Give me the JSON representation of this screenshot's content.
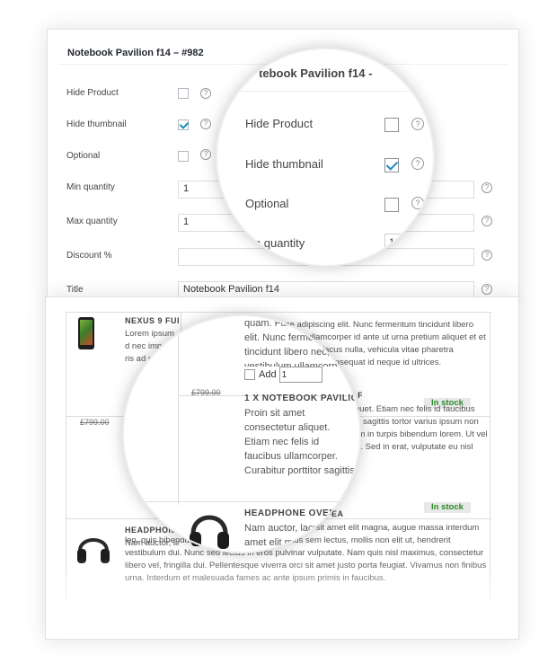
{
  "settings_panel": {
    "title": "Notebook Pavilion f14 – #982",
    "help_glyph": "?",
    "fields": {
      "hide_product": {
        "label": "Hide Product",
        "checked": false
      },
      "hide_thumbnail": {
        "label": "Hide thumbnail",
        "checked": true
      },
      "optional": {
        "label": "Optional",
        "checked": false
      },
      "min_quantity": {
        "label": "Min quantity",
        "value": "1"
      },
      "max_quantity": {
        "label": "Max quantity",
        "value": "1"
      },
      "discount": {
        "label": "Discount %",
        "value": ""
      },
      "title": {
        "label": "Title",
        "value": "Notebook Pavilion f14"
      }
    }
  },
  "zoom_top": {
    "title_fragment": "tebook Pavilion f14 -",
    "hide_product": "Hide Product",
    "hide_thumbnail": "Hide thumbnail",
    "optional": "Optional",
    "min_quantity_fragment": "in quantity",
    "min_value_fragment": "1"
  },
  "product_list": {
    "items": [
      {
        "title": "NEXUS 9 FULLHD",
        "desc": "Lorem ipsum d nec impe ris ad erat.",
        "old_price": "£799.00",
        "icon": "tablet-icon"
      },
      {
        "title": "1 X NOTEBOOK PAVILION F14",
        "desc": "Proin sit amet consectetur aliquet. Etiam nec felis id faucibus ullamcorper. Curabitur porttitor sagittis tortor varius ipsum non felis vulputate. Vivamus at enim in turpis bibendum lorem. Ut vel nibh rhoncus orci tincidunt sed. Sed in erat, vulputate eu nisl sed, semper",
        "old_price": "£799.00",
        "stock": "In stock"
      },
      {
        "title": "HEADPHONE OVER-EAR",
        "desc": "Nam auctor, lacus sit amet elit magna, augue massa interdum leo, quis bibendum elit magna id odio. Vivamus sem lectus, mollis non elit ut, hendrerit vestibulum dui. Nunc sed lectus in eros pulvinar vulputate. Nam quis nisl maximus, consectetur libero vel, fringilla dui. Pellentesque viverra orci sit amet justo porta feugiat. Vivamus non finibus urna. Interdum et malesuada fames ac ante ipsum primis in faucibus.",
        "stock": "In stock",
        "icon": "headphones-icon"
      }
    ],
    "top_text": "quam. Fusce adipiscing elit. Nunc fermentum tincidunt libero nec, vestibulum ullamcorper id ante ut urna pretium aliquet et et erat. Nunc interdum lacus nulla, vehicula vitae pharetra vulputate ipsum nec, consequat id neque id ultrices.",
    "add_label": "Add",
    "add_qty": "1",
    "small_headphone_title": "HEADPHONE OVER-EAR",
    "small_headphone_desc": "Nam auctor, lacus"
  }
}
